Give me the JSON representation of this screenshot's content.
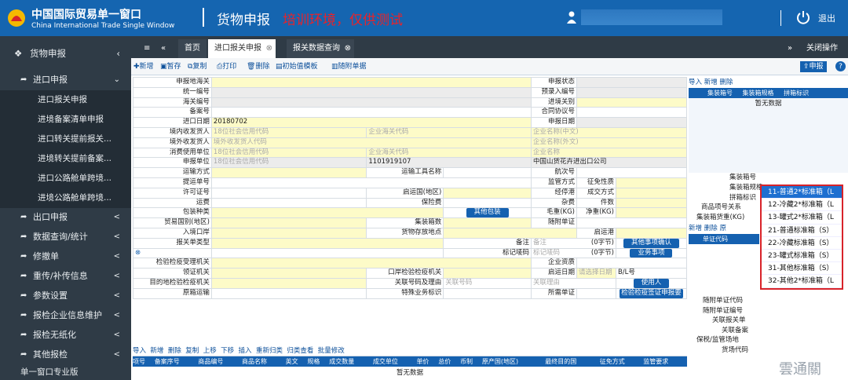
{
  "header": {
    "title_cn": "中国国际贸易单一窗口",
    "title_en": "China International Trade Single Window",
    "module": "货物申报",
    "env_warning": "培训环境，仅供测试",
    "logout": "退出"
  },
  "sidebar": {
    "top": "货物申报",
    "groups": [
      {
        "label": "进口申报",
        "arrow": "⌄",
        "subs": [
          "进口报关申报",
          "进境备案清单申报",
          "进口转关提前报关...",
          "进境转关提前备案...",
          "进口公路舱单跨境...",
          "进境公路舱单跨境..."
        ]
      },
      {
        "label": "出口申报",
        "arrow": "<"
      },
      {
        "label": "数据查询/统计",
        "arrow": "<"
      },
      {
        "label": "修撤单",
        "arrow": "<"
      },
      {
        "label": "重传/补传信息",
        "arrow": "<"
      },
      {
        "label": "参数设置",
        "arrow": "<"
      },
      {
        "label": "报检企业信息维护",
        "arrow": "<"
      },
      {
        "label": "报检无纸化",
        "arrow": "<"
      },
      {
        "label": "其他报检",
        "arrow": "<"
      }
    ],
    "footer": "单一窗口专业版"
  },
  "tabs": {
    "home": "首页",
    "t1": "进口报关申报",
    "t2": "报关数据查询",
    "close_ops": "关闭操作"
  },
  "toolbar": {
    "items": [
      "新增",
      "暂存",
      "复制",
      "打印",
      "删除",
      "初始值模板",
      "随附单据"
    ],
    "declare": "申报"
  },
  "form": {
    "decl_customs": "申报地海关",
    "decl_status": "申报状态",
    "uni_no": "统一编号",
    "pre_no": "预录入编号",
    "customs_no": "海关编号",
    "entry_port": "进境关别",
    "record_no": "备案号",
    "contract_no": "合同协议号",
    "import_date": "进口日期",
    "import_date_val": "20180702",
    "decl_date": "申报日期",
    "consignee": "境内收发货人",
    "foreign_consignee": "境外收发货人",
    "consumer": "消费使用单位",
    "declarant": "申报单位",
    "ph_credit": "18位社会信用代码",
    "ph_ent_code": "企业海关代码",
    "ph_ent_cn": "企业名称(中文)",
    "ph_foreign": "境外收发货人代码",
    "ph_ent_en": "企业名称(外文)",
    "ph_ent_name": "企业名称",
    "decl_code": "1101919107",
    "decl_name": "中国山货花卉进出口公司",
    "transport": "运输方式",
    "vehicle": "运输工具名称",
    "voyage": "航次号",
    "bl_no": "提运单号",
    "supervision": "监管方式",
    "tax_nature": "征免性质",
    "license": "许可证号",
    "origin_country": "启运国(地区)",
    "stop_port": "经停港",
    "deal_mode": "成交方式",
    "freight": "运费",
    "insurance": "保险费",
    "misc": "杂费",
    "packages": "件数",
    "pack_type": "包装种类",
    "other_pack": "其他包装",
    "gross": "毛重(KG)",
    "net": "净重(KG)",
    "trade_country": "贸易国别(地区)",
    "containers": "集装箱数",
    "docs": "随附单证",
    "entry_port2": "入境口岸",
    "storage": "货物存放地点",
    "depart_port": "启运港",
    "type": "报关单类型",
    "remark": "备注",
    "remark_ph": "备注",
    "bytes": "(0字节)",
    "other_confirm": "其他事项确认",
    "mark": "标记唛码",
    "mark_ph": "标记唛码",
    "bytes2": "(0字节)",
    "business": "业务事项",
    "insp_org": "检验检疫受理机关",
    "ent_qual": "企业资质",
    "claim_org": "领证机关",
    "port_org": "口岸检验检疫机关",
    "depart_date": "启运日期",
    "depart_date_ph": "请选择日期",
    "bl": "B/L号",
    "dest_org": "目的地检验检疫机关",
    "rel_no": "关联号码及理由",
    "rel_no_ph": "关联号码",
    "rel_reason_ph": "关联理由",
    "user": "使用人",
    "orig_trans": "原箱运输",
    "special": "特殊业务标识",
    "need_docs": "所需单证",
    "insp_sign": "检验检疫签证申报要"
  },
  "grid": {
    "toolbar": [
      "导入",
      "新增",
      "删除",
      "复制",
      "上移",
      "下移",
      "插入",
      "重新归类",
      "归类查看",
      "批量修改"
    ],
    "headers": [
      "项号",
      "备案序号",
      "商品编号",
      "检验检疫编码",
      "商品名称",
      "英文",
      "规格",
      "成交数量",
      "成交单位",
      "单价",
      "总价",
      "币制",
      "原产国(地区)",
      "最终目的国",
      "征免方式",
      "监管要求"
    ],
    "empty": "暂无数据"
  },
  "right": {
    "toolbar": [
      "导入",
      "新增",
      "删除"
    ],
    "headers": [
      "集装箱号",
      "集装箱规格",
      "拼箱标识"
    ],
    "empty": "暂无数据",
    "fields": [
      "集装箱号",
      "集装箱规格",
      "拼箱标识",
      "商品项号关系",
      "集装箱货重(KG)"
    ],
    "toolbar2": [
      "新增",
      "删除",
      "原"
    ],
    "sub_header": "单证代码",
    "fields2": [
      "随附单证代码",
      "随附单证编号",
      "关联报关单",
      "关联备案",
      "保税/监管场地",
      "货场代码"
    ]
  },
  "dropdown": {
    "options": [
      "11-普通2*标准箱（L",
      "12-冷藏2*标准箱（L",
      "13-罐式2*标准箱（L",
      "21-普通标准箱（S）",
      "22-冷藏标准箱（S）",
      "23-罐式标准箱（S）",
      "31-其他标准箱（S）",
      "32-其他2*标准箱（L"
    ],
    "selected": 0
  },
  "watermark": "雲通關"
}
